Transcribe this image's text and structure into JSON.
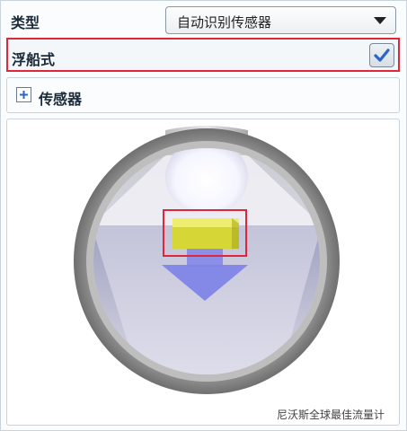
{
  "type_row": {
    "label": "类型",
    "selected_value": "自动识别传感器"
  },
  "float_row": {
    "label": "浮船式",
    "checked": true
  },
  "sensor_row": {
    "label": "传感器",
    "expand_symbol": "+"
  },
  "watermark": {
    "text": "尼沃斯全球最佳流量计"
  },
  "colors": {
    "highlight_border": "#e0263a",
    "check_color": "#2a64c8",
    "float_color": "#d8d83a",
    "arrow_color": "#7f84e6"
  }
}
